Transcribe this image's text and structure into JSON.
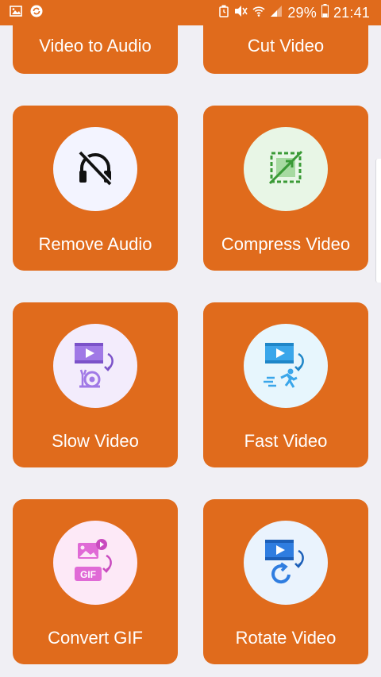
{
  "status_bar": {
    "battery_percent": "29%",
    "time": "21:41",
    "icons": [
      "image-icon",
      "sync-icon",
      "alarm-icon",
      "mute-icon",
      "wifi-icon",
      "signal-icon",
      "battery-icon"
    ]
  },
  "colors": {
    "accent": "#e06b1c",
    "background": "#f0eff4",
    "label": "#ffffff"
  },
  "tools": [
    {
      "label": "Video to Audio",
      "icon": "music-video-icon"
    },
    {
      "label": "Cut Video",
      "icon": "scissors-icon"
    },
    {
      "label": "Remove Audio",
      "icon": "headphones-off-icon",
      "circle_color": "#f3f4ff"
    },
    {
      "label": "Compress Video",
      "icon": "compress-icon",
      "circle_color": "#e8f6e6"
    },
    {
      "label": "Slow Video",
      "icon": "snail-video-icon",
      "circle_color": "#f3ecfc"
    },
    {
      "label": "Fast Video",
      "icon": "running-video-icon",
      "circle_color": "#e7f6fd"
    },
    {
      "label": "Convert GIF",
      "icon": "gif-icon",
      "circle_color": "#fde9f7"
    },
    {
      "label": "Rotate Video",
      "icon": "rotate-video-icon",
      "circle_color": "#eaf3fd"
    }
  ]
}
